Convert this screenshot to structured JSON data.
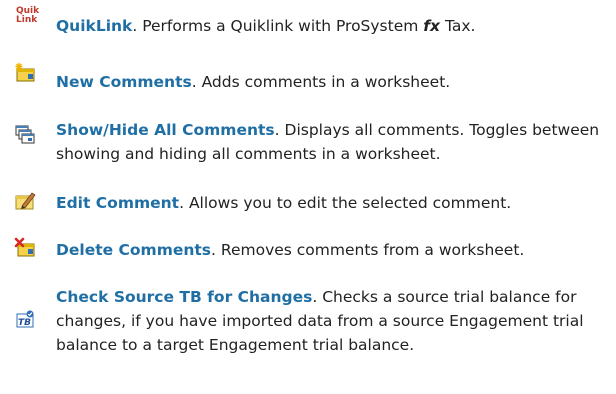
{
  "items": [
    {
      "icon": "quiklink-icon",
      "term": "QuikLink",
      "desc_before": ". Performs a Quiklink with ProSystem ",
      "desc_fx": "fx",
      "desc_after": " Tax.",
      "icon_text_1": "Quik",
      "icon_text_2": "Link"
    },
    {
      "icon": "new-comment-icon",
      "term": "New Comments",
      "desc": ". Adds comments in a worksheet."
    },
    {
      "icon": "show-hide-comments-icon",
      "term": "Show/Hide All Comments",
      "desc": ". Displays all comments. Toggles between showing and hiding all comments in a worksheet."
    },
    {
      "icon": "edit-comment-icon",
      "term": "Edit Comment",
      "desc": ". Allows you to edit the selected comment."
    },
    {
      "icon": "delete-comment-icon",
      "term": "Delete Comments",
      "desc": ". Removes comments from a worksheet."
    },
    {
      "icon": "check-source-tb-icon",
      "term": "Check Source TB for Changes",
      "desc": ". Checks a source trial balance for changes, if you have imported data from a source Engagement trial balance to a target Engagement trial balance.",
      "icon_text": "TB"
    }
  ]
}
